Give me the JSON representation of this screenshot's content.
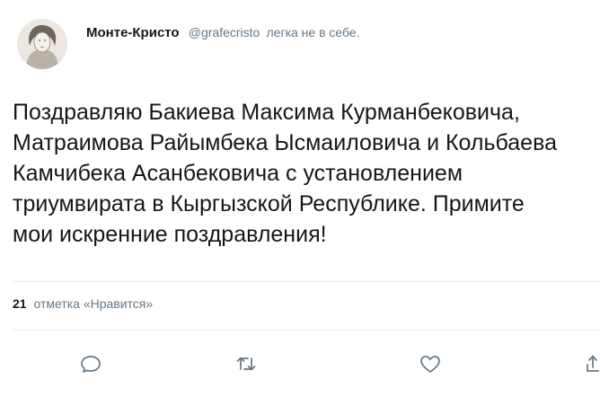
{
  "header": {
    "display_name": "Монте-Кристо",
    "handle": "@grafecristo",
    "bio": "легка не в себе."
  },
  "tweet": {
    "lines": [
      "Поздравляю Бакиева Максима Курманбековича,",
      "Матраимова Райымбека Ысмаиловича и Кольбаева",
      "Камчибека Асанбековича с установлением",
      "триумвирата в Кыргызской Республике. Примите",
      "мои искренние поздравления!"
    ]
  },
  "stats": {
    "likes_count": "21",
    "likes_label": "отметка «Нравится»"
  },
  "actions": {
    "reply_icon": "reply-icon",
    "retweet_icon": "retweet-icon",
    "like_icon": "heart-icon",
    "share_icon": "share-icon"
  },
  "colors": {
    "text": "#14171a",
    "secondary": "#657786",
    "divider": "#e6ecf0"
  }
}
